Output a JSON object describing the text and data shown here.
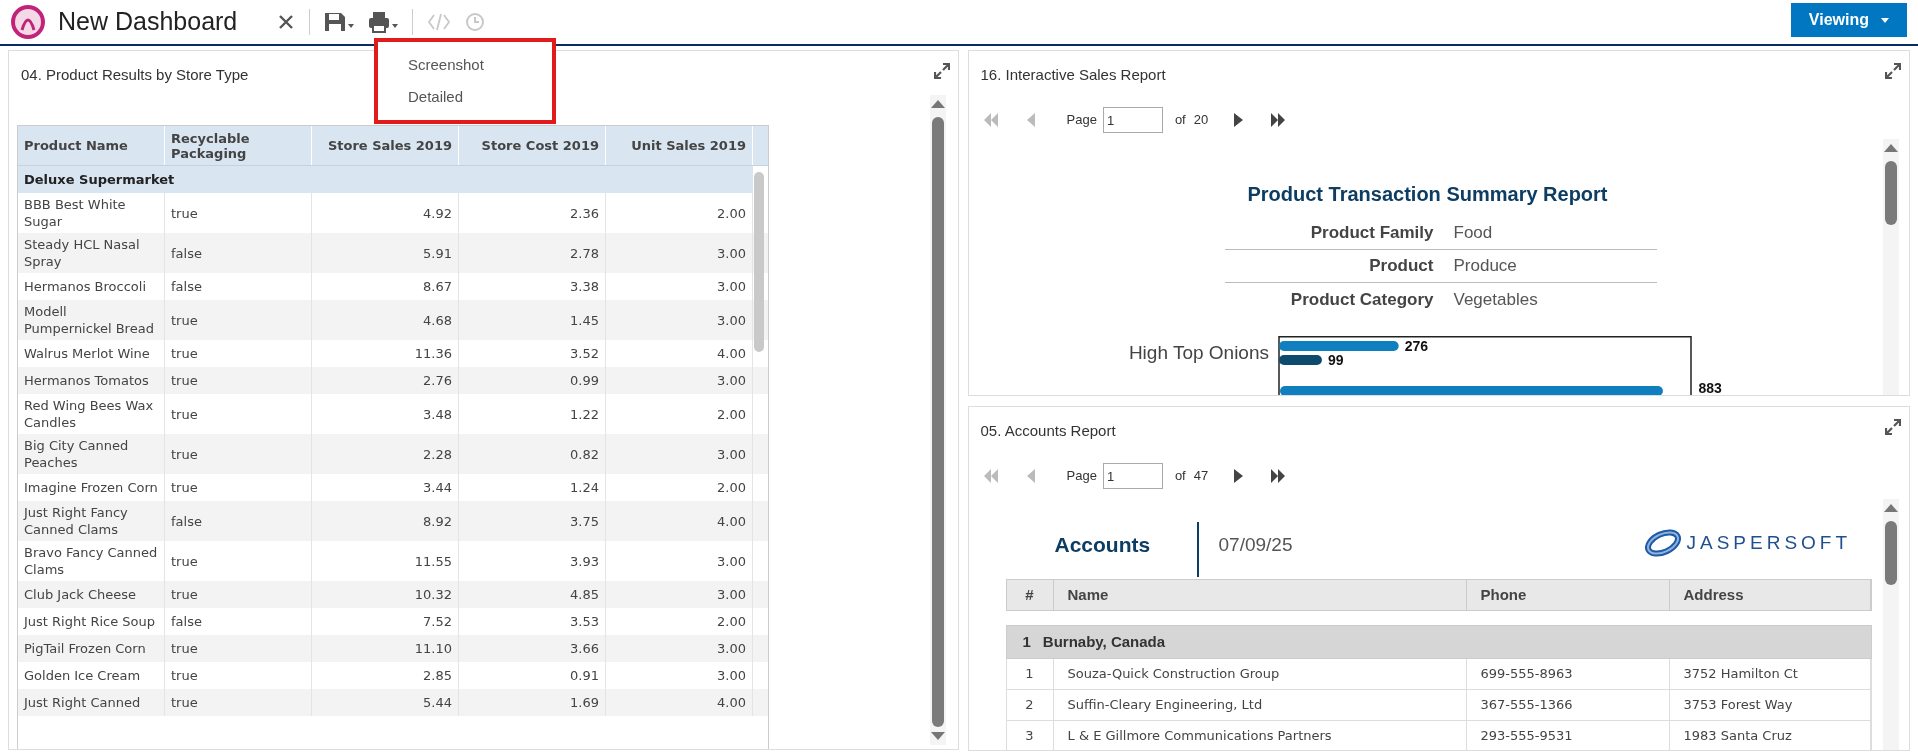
{
  "toolbar": {
    "title": "New Dashboard",
    "buttons": [
      {
        "kind": "close",
        "disabled": false
      },
      {
        "kind": "save",
        "disabled": false
      },
      {
        "kind": "print",
        "disabled": false
      },
      {
        "kind": "code",
        "disabled": true
      },
      {
        "kind": "clock",
        "disabled": true
      }
    ],
    "mode_button": "Viewing"
  },
  "print_menu": {
    "items": [
      "Screenshot",
      "Detailed"
    ]
  },
  "product_panel": {
    "title": "04. Product Results by Store Type",
    "columns": [
      "Product Name",
      "Recyclable Packaging",
      "Store Sales 2019",
      "Store Cost 2019",
      "Unit Sales 2019"
    ],
    "group": "Deluxe Supermarket",
    "rows": [
      [
        "BBB Best White Sugar",
        "true",
        "4.92",
        "2.36",
        "2.00"
      ],
      [
        "Steady HCL Nasal Spray",
        "false",
        "5.91",
        "2.78",
        "3.00"
      ],
      [
        "Hermanos Broccoli",
        "false",
        "8.67",
        "3.38",
        "3.00"
      ],
      [
        "Modell Pumpernickel Bread",
        "true",
        "4.68",
        "1.45",
        "3.00"
      ],
      [
        "Walrus Merlot Wine",
        "true",
        "11.36",
        "3.52",
        "4.00"
      ],
      [
        "Hermanos Tomatos",
        "true",
        "2.76",
        "0.99",
        "3.00"
      ],
      [
        "Red Wing Bees Wax Candles",
        "true",
        "3.48",
        "1.22",
        "2.00"
      ],
      [
        "Big City Canned Peaches",
        "true",
        "2.28",
        "0.82",
        "3.00"
      ],
      [
        "Imagine Frozen Corn",
        "true",
        "3.44",
        "1.24",
        "2.00"
      ],
      [
        "Just Right Fancy Canned Clams",
        "false",
        "8.92",
        "3.75",
        "4.00"
      ],
      [
        "Bravo Fancy Canned Clams",
        "true",
        "11.55",
        "3.93",
        "3.00"
      ],
      [
        "Club Jack Cheese",
        "true",
        "10.32",
        "4.85",
        "3.00"
      ],
      [
        "Just Right Rice Soup",
        "false",
        "7.52",
        "3.53",
        "2.00"
      ],
      [
        "PigTail Frozen Corn",
        "true",
        "11.10",
        "3.66",
        "3.00"
      ],
      [
        "Golden Ice Cream",
        "true",
        "2.85",
        "0.91",
        "3.00"
      ],
      [
        "Just Right Canned",
        "true",
        "5.44",
        "1.69",
        "4.00"
      ]
    ]
  },
  "sales_panel": {
    "title": "16. Interactive Sales Report",
    "pager": {
      "page_label": "Page",
      "page": "1",
      "of_label": "of",
      "total": "20",
      "first_disabled": true,
      "prev_disabled": true
    },
    "report_title": "Product Transaction Summary Report",
    "fields": [
      {
        "label": "Product Family",
        "value": "Food"
      },
      {
        "label": "Product",
        "value": "Produce"
      },
      {
        "label": "Product Category",
        "value": "Vegetables"
      }
    ],
    "chart_data": {
      "type": "bar",
      "orientation": "horizontal",
      "categories": [
        "High Top Onions"
      ],
      "data_labels": true,
      "series": [
        {
          "color": "#0f7fc0",
          "values": [
            276
          ]
        },
        {
          "color": "#0c4a6e",
          "values": [
            99
          ]
        }
      ]
    },
    "partial_bar_label": "883"
  },
  "accounts_panel": {
    "title": "05. Accounts Report",
    "pager": {
      "page_label": "Page",
      "page": "1",
      "of_label": "of",
      "total": "47",
      "first_disabled": true,
      "prev_disabled": true
    },
    "report_title": "Accounts",
    "date": "07/09/25",
    "logo_text": "JASPERSOFT",
    "columns": [
      "#",
      "Name",
      "Phone",
      "Address"
    ],
    "group": {
      "number": "1",
      "name": "Burnaby, Canada"
    },
    "rows": [
      [
        "1",
        "Souza-Quick Construction Group",
        "699-555-8963",
        "3752 Hamilton Ct"
      ],
      [
        "2",
        "Suffin-Cleary Engineering, Ltd",
        "367-555-1366",
        "3753 Forest Way"
      ],
      [
        "3",
        "L & E Gillmore Communications Partners",
        "293-555-9531",
        "1983 Santa Cruz"
      ]
    ]
  }
}
